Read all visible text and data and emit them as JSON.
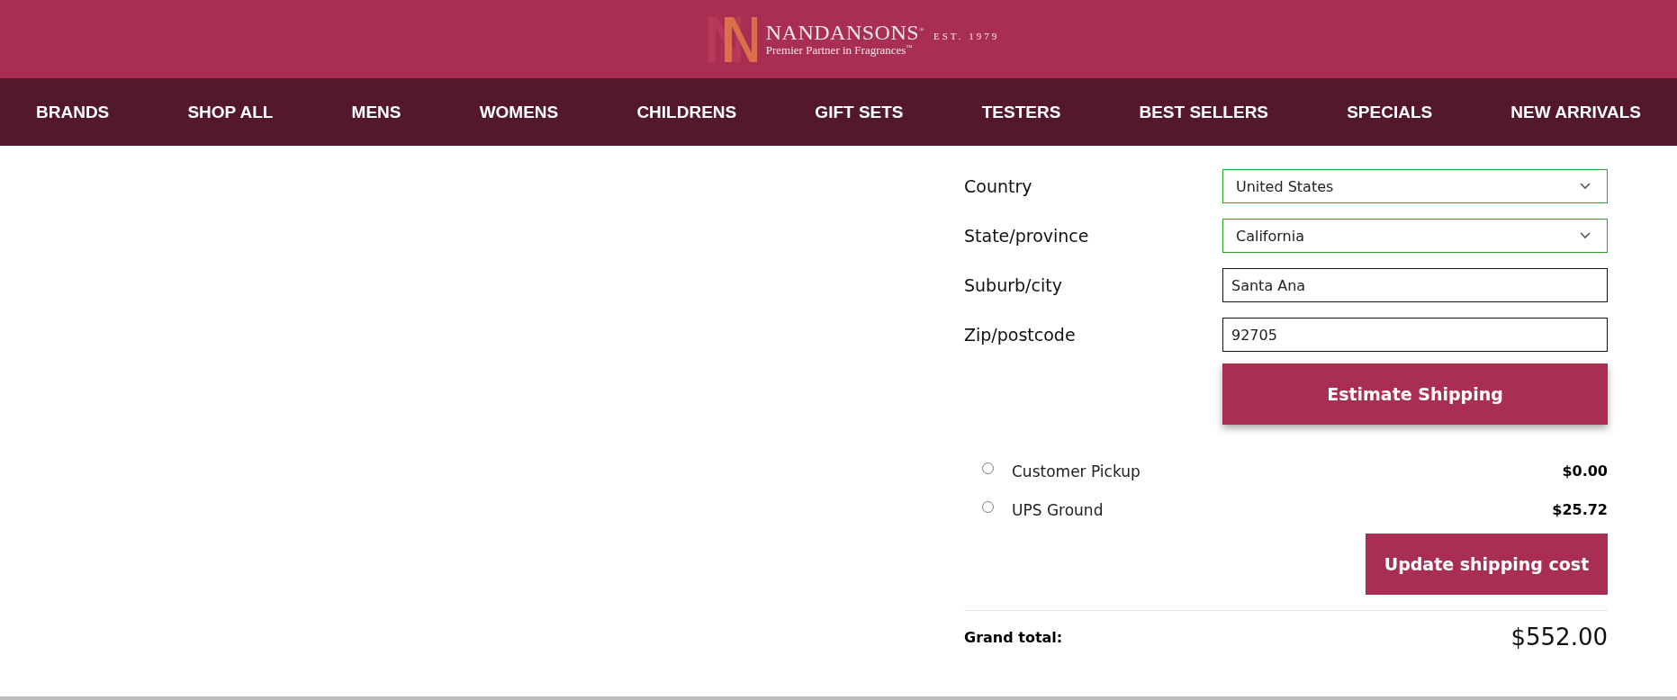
{
  "header": {
    "logo_name": "NANDANSONS",
    "logo_mark": "®",
    "established": "EST. 1979",
    "tagline": "Premier Partner in Fragrances",
    "tagline_mark": "™"
  },
  "nav": [
    "BRANDS",
    "SHOP ALL",
    "MENS",
    "WOMENS",
    "CHILDRENS",
    "GIFT SETS",
    "TESTERS",
    "BEST SELLERS",
    "SPECIALS",
    "NEW ARRIVALS"
  ],
  "shipping_form": {
    "fields": [
      {
        "label": "Country",
        "kind": "select",
        "value": "United States"
      },
      {
        "label": "State/province",
        "kind": "select",
        "value": "California"
      },
      {
        "label": "Suburb/city",
        "kind": "text",
        "value": "Santa Ana"
      },
      {
        "label": "Zip/postcode",
        "kind": "text",
        "value": "92705"
      }
    ],
    "estimate_button": "Estimate Shipping"
  },
  "shipping_options": [
    {
      "label": "Customer Pickup",
      "price": "$0.00",
      "selected": false
    },
    {
      "label": "UPS Ground",
      "price": "$25.72",
      "selected": false
    }
  ],
  "update_button": "Update shipping cost",
  "grand_total": {
    "label": "Grand total:",
    "value": "$552.00"
  }
}
